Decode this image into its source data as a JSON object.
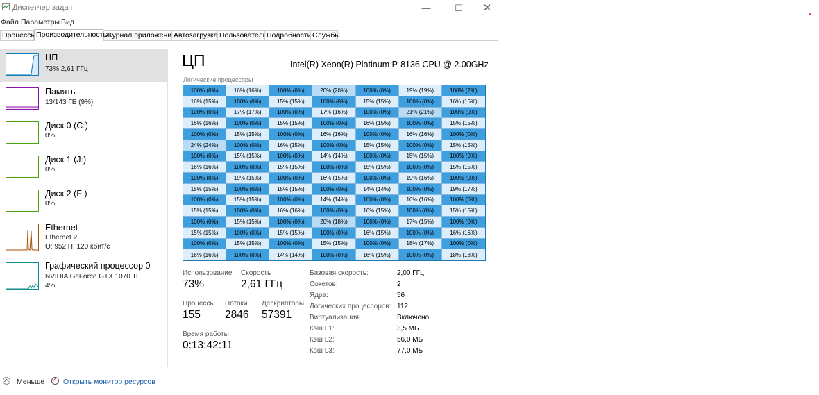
{
  "window": {
    "title": "Диспетчер задач",
    "minimize": "—",
    "maximize": "☐",
    "close": "✕"
  },
  "menu": [
    "Файл",
    "Параметры",
    "Вид"
  ],
  "tabs": [
    "Процессы",
    "Производительность",
    "Журнал приложений",
    "Автозагрузка",
    "Пользователи",
    "Подробности",
    "Службы"
  ],
  "active_tab": "Производительность",
  "sidebar": [
    {
      "name": "ЦП",
      "sub1": "73% 2,61 ГГц",
      "sub2": "",
      "color": "#117dbb"
    },
    {
      "name": "Память",
      "sub1": "13/143 ГБ (9%)",
      "sub2": "",
      "color": "#8b12ae"
    },
    {
      "name": "Диск 0 (C:)",
      "sub1": "0%",
      "sub2": "",
      "color": "#4da60c"
    },
    {
      "name": "Диск 1 (J:)",
      "sub1": "0%",
      "sub2": "",
      "color": "#4da60c"
    },
    {
      "name": "Диск 2 (F:)",
      "sub1": "0%",
      "sub2": "",
      "color": "#4da60c"
    },
    {
      "name": "Ethernet",
      "sub1": "Ethernet 2",
      "sub2": "О: 952 П: 120 кбит/с",
      "color": "#a74f01"
    },
    {
      "name": "Графический процессор 0",
      "sub1": "NVIDIA GeForce GTX 1070 Ti",
      "sub2": "4%",
      "color": "#0f8c8c"
    }
  ],
  "cpu": {
    "title": "ЦП",
    "model": "Intel(R) Xeon(R) Platinum P-8136 CPU @ 2.00GHz",
    "grid_label": "Логические процессоры",
    "grid": [
      [
        "100% (0%)",
        "16% (16%)",
        "100% (0%)",
        "20% (20%)",
        "100% (0%)",
        "19% (19%)",
        "100% (2%)"
      ],
      [
        "16% (15%)",
        "100% (0%)",
        "15% (15%)",
        "100% (0%)",
        "15% (15%)",
        "100% (0%)",
        "16% (16%)"
      ],
      [
        "100% (0%)",
        "17% (17%)",
        "100% (0%)",
        "17% (16%)",
        "100% (0%)",
        "21% (21%)",
        "100% (0%)"
      ],
      [
        "16% (16%)",
        "100% (0%)",
        "15% (15%)",
        "100% (0%)",
        "16% (15%)",
        "100% (0%)",
        "15% (15%)"
      ],
      [
        "100% (0%)",
        "15% (15%)",
        "100% (0%)",
        "16% (16%)",
        "100% (0%)",
        "16% (16%)",
        "100% (0%)"
      ],
      [
        "24% (24%)",
        "100% (0%)",
        "16% (15%)",
        "100% (0%)",
        "15% (15%)",
        "100% (0%)",
        "15% (15%)"
      ],
      [
        "100% (0%)",
        "15% (15%)",
        "100% (0%)",
        "14% (14%)",
        "100% (0%)",
        "15% (15%)",
        "100% (0%)"
      ],
      [
        "16% (16%)",
        "100% (0%)",
        "15% (15%)",
        "100% (0%)",
        "15% (15%)",
        "100% (0%)",
        "15% (15%)"
      ],
      [
        "100% (0%)",
        "19% (15%)",
        "100% (0%)",
        "16% (15%)",
        "100% (0%)",
        "19% (16%)",
        "100% (0%)"
      ],
      [
        "15% (15%)",
        "100% (0%)",
        "15% (15%)",
        "100% (0%)",
        "14% (14%)",
        "100% (0%)",
        "19% (17%)"
      ],
      [
        "100% (0%)",
        "15% (15%)",
        "100% (0%)",
        "14% (14%)",
        "100% (0%)",
        "16% (16%)",
        "100% (0%)"
      ],
      [
        "15% (15%)",
        "100% (0%)",
        "16% (16%)",
        "100% (0%)",
        "16% (15%)",
        "100% (0%)",
        "15% (15%)"
      ],
      [
        "100% (0%)",
        "15% (15%)",
        "100% (0%)",
        "20% (18%)",
        "100% (0%)",
        "17% (15%)",
        "100% (0%)"
      ],
      [
        "15% (15%)",
        "100% (0%)",
        "15% (15%)",
        "100% (0%)",
        "16% (15%)",
        "100% (0%)",
        "16% (16%)"
      ],
      [
        "100% (0%)",
        "15% (15%)",
        "100% (0%)",
        "15% (15%)",
        "100% (0%)",
        "18% (17%)",
        "100% (0%)"
      ],
      [
        "16% (16%)",
        "100% (0%)",
        "14% (14%)",
        "100% (0%)",
        "16% (15%)",
        "100% (0%)",
        "18% (18%)"
      ]
    ],
    "colors": {
      "high": "#3e9ede",
      "low_light": "#dceefb",
      "low_mid": "#b8dcf5",
      "grid_border": "#1f78b4"
    },
    "stats": {
      "usage_label": "Использование",
      "usage": "73%",
      "speed_label": "Скорость",
      "speed": "2,61 ГГц",
      "processes_label": "Процессы",
      "processes": "155",
      "threads_label": "Потоки",
      "threads": "2846",
      "handles_label": "Дескрипторы",
      "handles": "57391",
      "uptime_label": "Время работы",
      "uptime": "0:13:42:11"
    },
    "details": [
      {
        "label": "Базовая скорость:",
        "value": "2,00 ГГц"
      },
      {
        "label": "Сокетов:",
        "value": "2"
      },
      {
        "label": "Ядра:",
        "value": "56"
      },
      {
        "label": "Логических процессоров:",
        "value": "112"
      },
      {
        "label": "Виртуализация:",
        "value": "Включено"
      },
      {
        "label": "Кэш L1:",
        "value": "3,5 МБ"
      },
      {
        "label": "Кэш L2:",
        "value": "56,0 МБ"
      },
      {
        "label": "Кэш L3:",
        "value": "77,0 МБ"
      }
    ]
  },
  "footer": {
    "less": "Меньше",
    "monitor": "Открыть монитор ресурсов"
  }
}
